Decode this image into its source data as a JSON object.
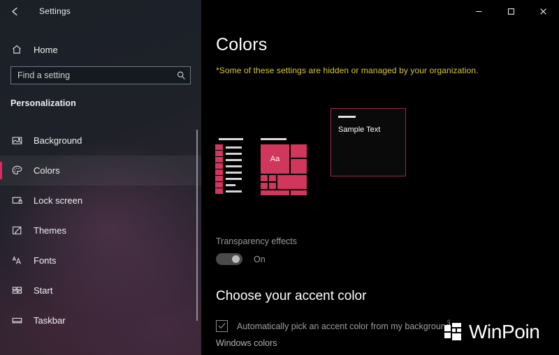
{
  "window": {
    "title": "Settings",
    "back_icon": "back-arrow-icon",
    "controls": {
      "minimize": "minimize-icon",
      "maximize": "maximize-icon",
      "close": "close-icon"
    }
  },
  "sidebar": {
    "home": {
      "label": "Home",
      "icon": "home-icon"
    },
    "search": {
      "placeholder": "Find a setting",
      "value": "",
      "icon": "search-icon"
    },
    "category": "Personalization",
    "items": [
      {
        "label": "Background",
        "icon": "image-icon",
        "selected": false
      },
      {
        "label": "Colors",
        "icon": "palette-icon",
        "selected": true
      },
      {
        "label": "Lock screen",
        "icon": "lock-screen-icon",
        "selected": false
      },
      {
        "label": "Themes",
        "icon": "brush-icon",
        "selected": false
      },
      {
        "label": "Fonts",
        "icon": "fonts-icon",
        "selected": false
      },
      {
        "label": "Start",
        "icon": "start-tiles-icon",
        "selected": false
      },
      {
        "label": "Taskbar",
        "icon": "taskbar-icon",
        "selected": false
      }
    ]
  },
  "main": {
    "title": "Colors",
    "org_note": "*Some of these settings are hidden or managed by your organization.",
    "preview": {
      "tile_text": "Aa",
      "window_sample_text": "Sample Text"
    },
    "transparency": {
      "label": "Transparency effects",
      "state_label": "On",
      "enabled": true
    },
    "accent": {
      "heading": "Choose your accent color",
      "auto_pick_label": "Automatically pick an accent color from my background",
      "auto_pick_checked": true,
      "windows_colors_label": "Windows colors"
    }
  },
  "watermark": {
    "text": "WinPoin",
    "mark_icon": "winpoin-squares-icon",
    "corner_letter": "d"
  },
  "colors": {
    "accent": "#d1365c",
    "accent_bar": "#e02a5b",
    "org_note": "#d7c837",
    "window_border": "#9e2a48",
    "content_bg": "#000000"
  }
}
